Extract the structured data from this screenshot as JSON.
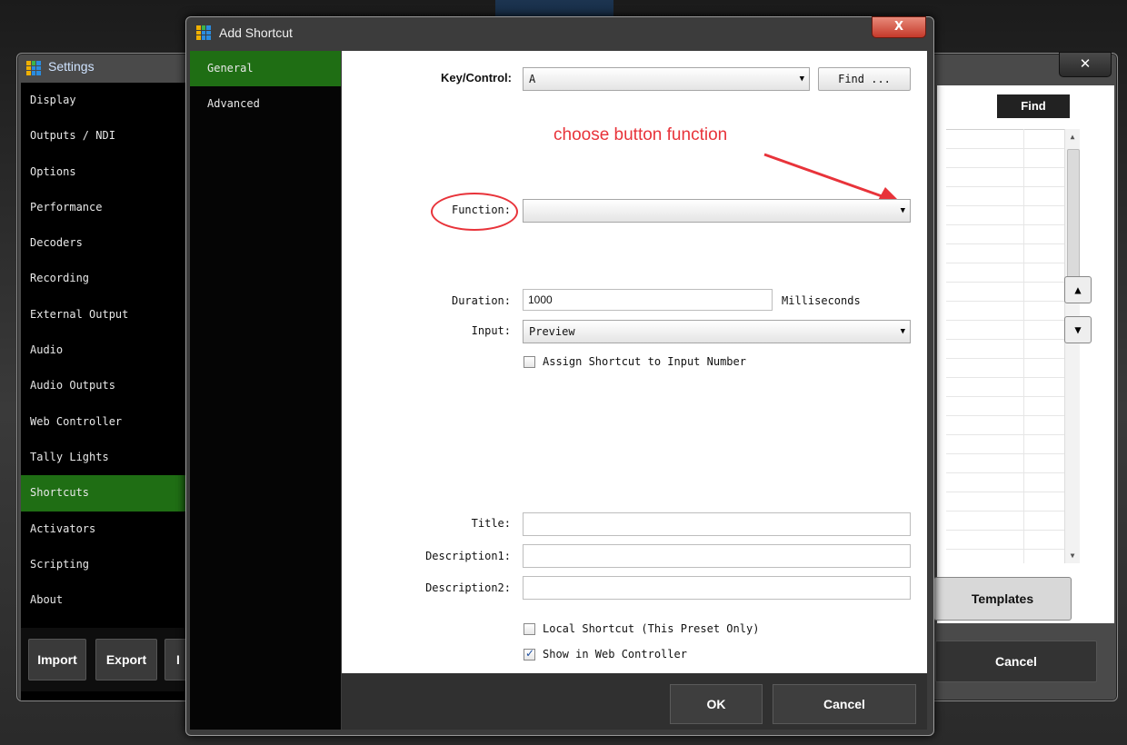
{
  "settings_window": {
    "title": "Settings",
    "close_glyph": "✕",
    "nav_items": [
      "Display",
      "Outputs / NDI",
      "Options",
      "Performance",
      "Decoders",
      "Recording",
      "External Output",
      "Audio",
      "Audio Outputs",
      "Web Controller",
      "Tally Lights",
      "Shortcuts",
      "Activators",
      "Scripting",
      "About"
    ],
    "active_nav": "Shortcuts",
    "import_label": "Import",
    "export_label": "Export",
    "partial_button_label": "I",
    "find_label": "Find",
    "templates_label": "Templates",
    "cancel_label": "Cancel",
    "up_arrow": "▲",
    "down_arrow": "▼"
  },
  "dialog": {
    "title": "Add Shortcut",
    "close_glyph": "X",
    "nav_items": [
      "General",
      "Advanced"
    ],
    "active_nav": "General",
    "key_control_label": "Key/Control:",
    "key_control_value": "A",
    "find_button": "Find ...",
    "function_label": "Function:",
    "function_value": "",
    "duration_label": "Duration:",
    "duration_value": "1000",
    "duration_unit": "Milliseconds",
    "input_label": "Input:",
    "input_value": "Preview",
    "assign_checkbox_label": "Assign Shortcut to Input Number",
    "assign_checked": false,
    "title_label": "Title:",
    "title_value": "",
    "description1_label": "Description1:",
    "description1_value": "",
    "description2_label": "Description2:",
    "description2_value": "",
    "local_shortcut_label": "Local Shortcut (This Preset Only)",
    "local_checked": false,
    "show_in_web_label": "Show in Web Controller",
    "show_in_web_checked": true,
    "ok_label": "OK",
    "cancel_label": "Cancel"
  },
  "annotation": {
    "text": "choose  button function",
    "color": "#e8333a"
  },
  "icons": {
    "dropdown": "▼",
    "app_logo": "vmix-logo-icon"
  }
}
